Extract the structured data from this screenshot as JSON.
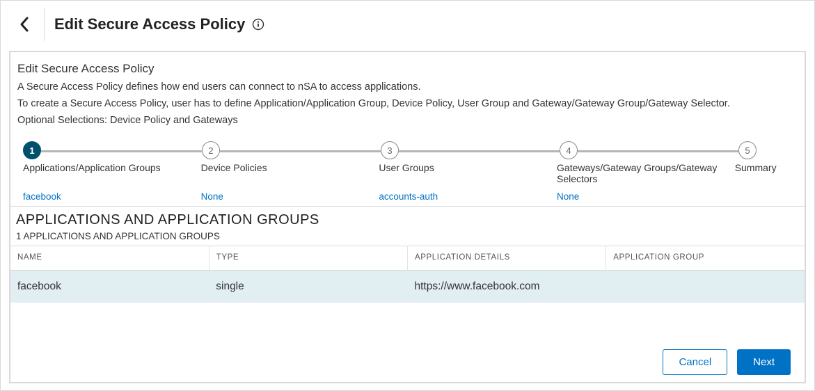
{
  "header": {
    "title": "Edit Secure Access Policy"
  },
  "intro": {
    "heading": "Edit Secure Access Policy",
    "line1": "A Secure Access Policy defines how end users can connect to nSA to access applications.",
    "line2": "To create a Secure Access Policy, user has to define Application/Application Group, Device Policy, User Group and Gateway/Gateway Group/Gateway Selector.",
    "line3": "Optional Selections: Device Policy and Gateways"
  },
  "steps": [
    {
      "num": "1",
      "label": "Applications/Application Groups",
      "value": "facebook",
      "active": true
    },
    {
      "num": "2",
      "label": "Device Policies",
      "value": "None",
      "active": false
    },
    {
      "num": "3",
      "label": "User Groups",
      "value": "accounts-auth",
      "active": false
    },
    {
      "num": "4",
      "label": "Gateways/Gateway Groups/Gateway Selectors",
      "value": "None",
      "active": false
    },
    {
      "num": "5",
      "label": "Summary",
      "value": "",
      "active": false
    }
  ],
  "section": {
    "title": "APPLICATIONS AND APPLICATION GROUPS",
    "subtitle": "1 APPLICATIONS AND APPLICATION GROUPS"
  },
  "table": {
    "headers": [
      "NAME",
      "TYPE",
      "APPLICATION DETAILS",
      "APPLICATION GROUP"
    ],
    "rows": [
      {
        "name": "facebook",
        "type": "single",
        "details": "https://www.facebook.com",
        "group": ""
      }
    ]
  },
  "footer": {
    "cancel": "Cancel",
    "next": "Next"
  }
}
